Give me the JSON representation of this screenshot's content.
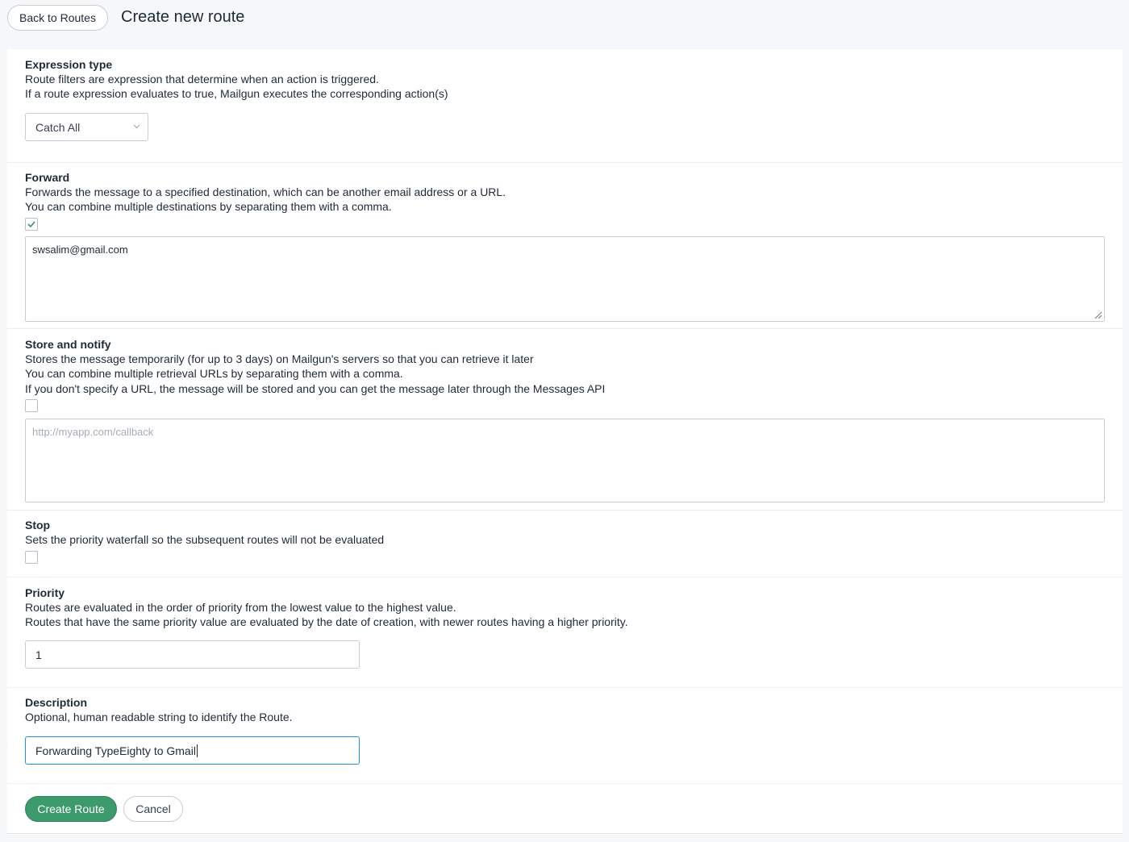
{
  "header": {
    "back_label": "Back to Routes",
    "title": "Create new route"
  },
  "expression": {
    "label": "Expression type",
    "desc1": "Route filters are expression that determine when an action is triggered.",
    "desc2": "If a route expression evaluates to true, Mailgun executes the corresponding action(s)",
    "selected": "Catch All"
  },
  "forward": {
    "label": "Forward",
    "desc1": "Forwards the message to a specified destination, which can be another email address or a URL.",
    "desc2": "You can combine multiple destinations by separating them with a comma.",
    "checked": true,
    "value": "swsalim@gmail.com"
  },
  "store": {
    "label": "Store and notify",
    "desc1": "Stores the message temporarily (for up to 3 days) on Mailgun's servers so that you can retrieve it later",
    "desc2": "You can combine multiple retrieval URLs by separating them with a comma.",
    "desc3": "If you don't specify a URL, the message will be stored and you can get the message later through the Messages API",
    "checked": false,
    "placeholder": "http://myapp.com/callback"
  },
  "stop": {
    "label": "Stop",
    "desc1": "Sets the priority waterfall so the subsequent routes will not be evaluated",
    "checked": false
  },
  "priority": {
    "label": "Priority",
    "desc1": "Routes are evaluated in the order of priority from the lowest value to the highest value.",
    "desc2": "Routes that have the same priority value are evaluated by the date of creation, with newer routes having a higher priority.",
    "value": "1"
  },
  "description": {
    "label": "Description",
    "desc1": "Optional, human readable string to identify the Route.",
    "value": "Forwarding TypeEighty to Gmail"
  },
  "actions": {
    "create_label": "Create Route",
    "cancel_label": "Cancel"
  },
  "colors": {
    "primary": "#3d9a6c",
    "focus": "#2b8fd6"
  }
}
